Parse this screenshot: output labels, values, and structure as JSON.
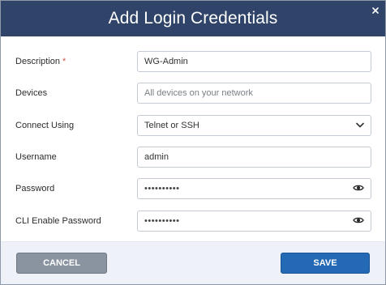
{
  "dialog": {
    "title": "Add Login Credentials",
    "close_icon": "close-icon"
  },
  "form": {
    "description": {
      "label": "Description",
      "required_marker": "*",
      "value": "WG-Admin"
    },
    "devices": {
      "label": "Devices",
      "placeholder": "All devices on your network"
    },
    "connect_using": {
      "label": "Connect Using",
      "selected": "Telnet or SSH",
      "icon": "chevron-down-icon"
    },
    "username": {
      "label": "Username",
      "value": "admin"
    },
    "password": {
      "label": "Password",
      "value": "••••••••••",
      "icon": "eye-icon"
    },
    "cli_enable_password": {
      "label": "CLI Enable Password",
      "value": "••••••••••",
      "icon": "eye-icon"
    }
  },
  "footer": {
    "cancel_label": "CANCEL",
    "save_label": "SAVE"
  },
  "colors": {
    "header_bg": "#2f4468",
    "required": "#d9534f",
    "cancel_bg": "#8a94a1",
    "save_bg": "#2469b3",
    "footer_bg": "#eef1f7"
  }
}
